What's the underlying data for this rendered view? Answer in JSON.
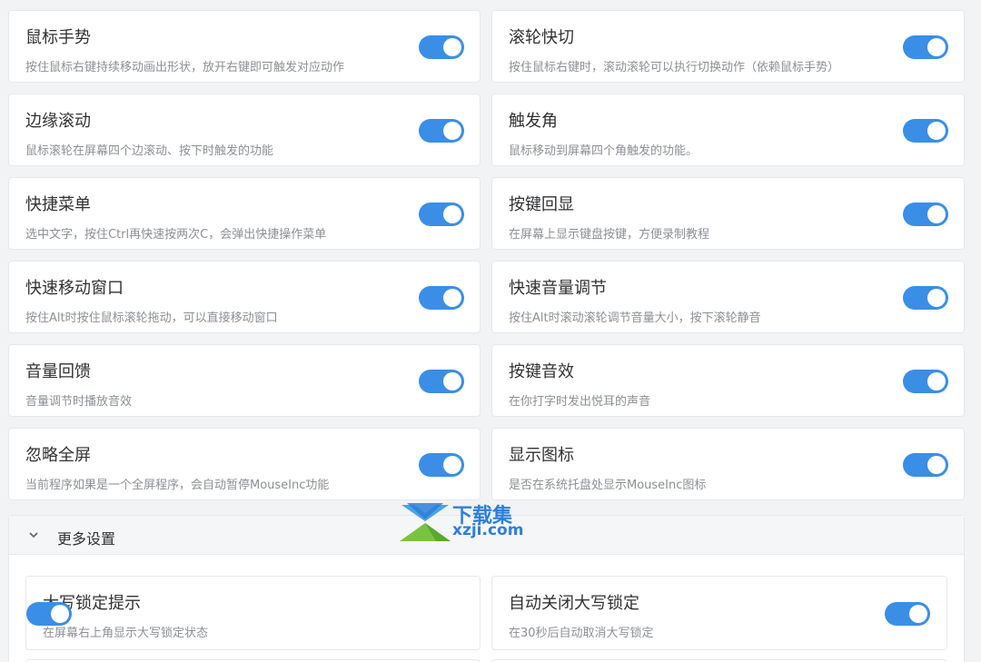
{
  "settings": [
    {
      "title": "鼠标手势",
      "desc": "按住鼠标右键持续移动画出形状，放开右键即可触发对应动作",
      "enabled": true
    },
    {
      "title": "滚轮快切",
      "desc": "按住鼠标右键时，滚动滚轮可以执行切换动作（依赖鼠标手势）",
      "enabled": true
    },
    {
      "title": "边缘滚动",
      "desc": "鼠标滚轮在屏幕四个边滚动、按下时触发的功能",
      "enabled": true
    },
    {
      "title": "触发角",
      "desc": "鼠标移动到屏幕四个角触发的功能。",
      "enabled": true
    },
    {
      "title": "快捷菜单",
      "desc": "选中文字，按住Ctrl再快速按两次C，会弹出快捷操作菜单",
      "enabled": true
    },
    {
      "title": "按键回显",
      "desc": "在屏幕上显示键盘按键，方便录制教程",
      "enabled": true
    },
    {
      "title": "快速移动窗口",
      "desc": "按住Alt时按住鼠标滚轮拖动，可以直接移动窗口",
      "enabled": true
    },
    {
      "title": "快速音量调节",
      "desc": "按住Alt时滚动滚轮调节音量大小，按下滚轮静音",
      "enabled": true
    },
    {
      "title": "音量回馈",
      "desc": "音量调节时播放音效",
      "enabled": true
    },
    {
      "title": "按键音效",
      "desc": "在你打字时发出悦耳的声音",
      "enabled": true
    },
    {
      "title": "忽略全屏",
      "desc": "当前程序如果是一个全屏程序，会自动暂停MouseInc功能",
      "enabled": true
    },
    {
      "title": "显示图标",
      "desc": "是否在系统托盘处显示MouseInc图标",
      "enabled": true
    }
  ],
  "more_settings": {
    "label": "更多设置",
    "expanded": true,
    "items": [
      {
        "title": "大写锁定提示",
        "desc": "在屏幕右上角显示大写锁定状态",
        "enabled": true
      },
      {
        "title": "自动关闭大写锁定",
        "desc": "在30秒后自动取消大写锁定",
        "enabled": true
      }
    ]
  },
  "watermark": {
    "cn": "下载集",
    "en": "xzji.com"
  },
  "colors": {
    "accent": "#3a8ee6",
    "background": "#f2f3f5",
    "card": "#ffffff"
  }
}
